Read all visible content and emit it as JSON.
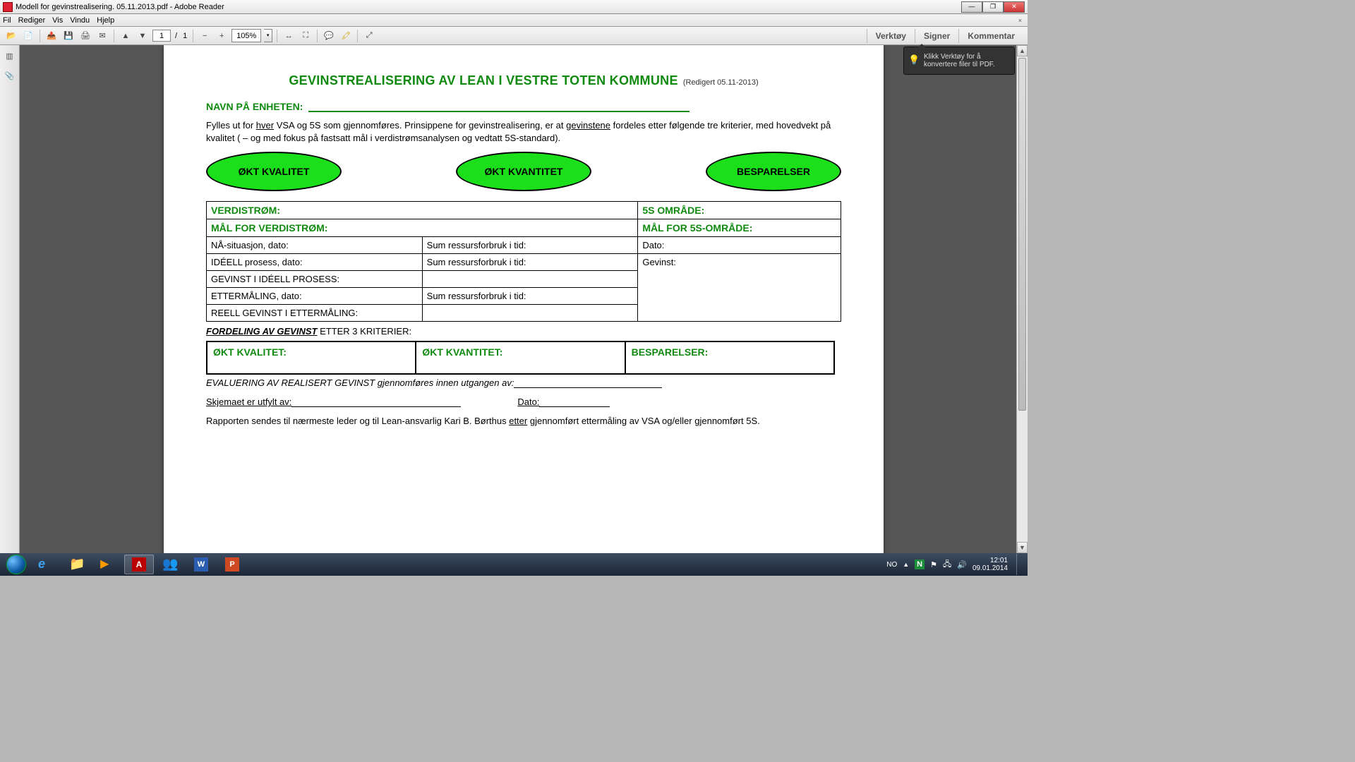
{
  "window": {
    "title": "Modell for gevinstrealisering. 05.11.2013.pdf - Adobe Reader"
  },
  "menu": {
    "items": [
      "Fil",
      "Rediger",
      "Vis",
      "Vindu",
      "Hjelp"
    ]
  },
  "toolbar": {
    "page_current": "1",
    "page_sep": "/",
    "page_total": "1",
    "zoom": "105%"
  },
  "right_tabs": {
    "tools": "Verktøy",
    "sign": "Signer",
    "comment": "Kommentar"
  },
  "tip": {
    "text": "Klikk Verktøy for å konvertere filer til PDF."
  },
  "document": {
    "title_main": "GEVINSTREALISERING AV LEAN I VESTRE TOTEN KOMMUNE",
    "title_edited": "(Redigert 05.11-2013)",
    "unit_label": "NAVN PÅ ENHETEN:",
    "intro_pre": "Fylles ut for ",
    "intro_u1": "hver",
    "intro_mid": " VSA og 5S som gjennomføres. Prinsippene for gevinstrealisering, er at ",
    "intro_u2": "gevinstene",
    "intro_post": " fordeles etter følgende tre kriterier, med hovedvekt på kvalitet ( – og med fokus på fastsatt mål i verdistrømsanalysen og vedtatt 5S-standard).",
    "oval1": "ØKT KVALITET",
    "oval2": "ØKT KVANTITET",
    "oval3": "BESPARELSER",
    "t1": {
      "h1": "VERDISTRØM:",
      "h2": "5S OMRÅDE:",
      "h3": "MÅL FOR VERDISTRØM:",
      "h4": "MÅL FOR 5S-OMRÅDE:",
      "r1c1": "NÅ-situasjon, dato:",
      "r1c2": "Sum ressursforbruk i tid:",
      "r1c3": "Dato:",
      "r2c1": "IDÉELL prosess, dato:",
      "r2c2": "Sum ressursforbruk i tid:",
      "r2c3": "Gevinst:",
      "r3c1": "GEVINST I IDÉELL PROSESS:",
      "r4c1": "ETTERMÅLING, dato:",
      "r4c2": "Sum ressursforbruk i tid:",
      "r5c1": "REELL GEVINST I ETTERMÅLING:"
    },
    "sect_u": "FORDELING AV GEVINST",
    "sect_rest": " ETTER 3 KRITERIER:",
    "t2": {
      "h1": "ØKT KVALITET:",
      "h2": "ØKT KVANTITET:",
      "h3": "BESPARELSER:"
    },
    "eval_pre": "EVALUERING AV REALISERT GEVINST gjennomføres innen utgangen av:",
    "sign_by": "Skjemaet er utfylt av:",
    "sign_date": "Dato:",
    "footer_pre": "Rapporten sendes til nærmeste leder og til Lean-ansvarlig Kari B. Børthus ",
    "footer_u": "etter",
    "footer_post": " gjennomført ettermåling av VSA og/eller gjennomført 5S."
  },
  "tray": {
    "lang": "NO",
    "time": "12:01",
    "date": "09.01.2014"
  }
}
